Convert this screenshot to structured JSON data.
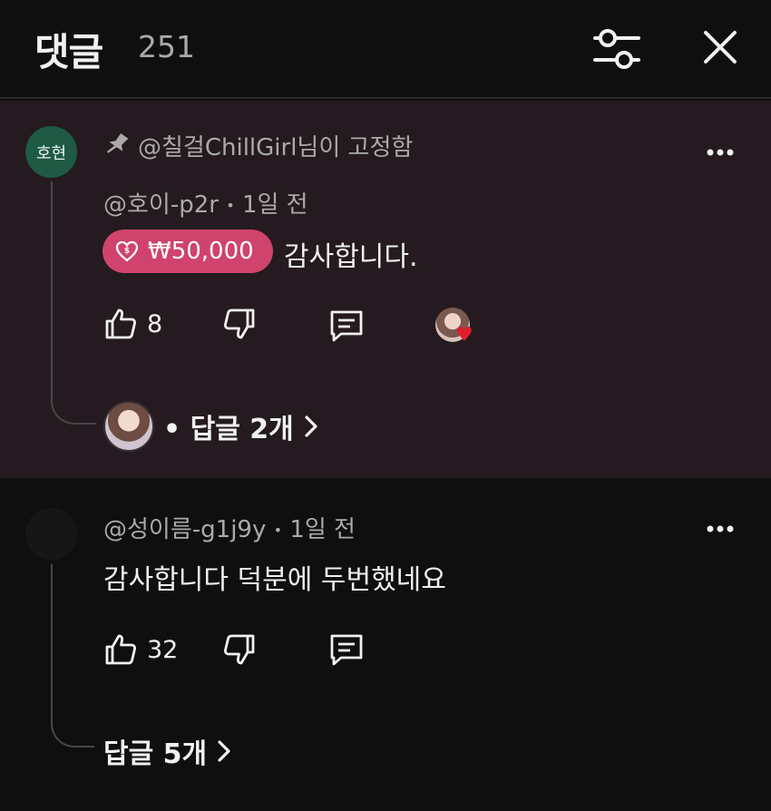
{
  "header": {
    "title": "댓글",
    "count": "251"
  },
  "pinned_comment": {
    "avatar_text": "호현",
    "pinned_label": "@칠걸ChillGirl님이 고정함",
    "author": "@호이-p2r",
    "separator": "•",
    "time": "1일 전",
    "thanks_amount": "₩50,000",
    "text": "감사합니다.",
    "likes": "8",
    "replies_label": "• 답글 2개",
    "colors": {
      "background": "#241a1f",
      "thanks_badge": "#d0436c",
      "heart": "#e11d2a"
    }
  },
  "second_comment": {
    "author": "@성이름-g1j9y",
    "separator": "•",
    "time": "1일 전",
    "text": "감사합니다 덕분에 두번했네요",
    "likes": "32",
    "replies_label": "답글 5개"
  },
  "icons": {
    "filter": "sliders-icon",
    "close": "close-icon",
    "pin": "pin-icon",
    "more": "more-vert-icon",
    "like": "thumb-up-icon",
    "dislike": "thumb-down-icon",
    "reply": "comment-icon",
    "thanks": "heart-dollar-icon",
    "chevron": "chevron-right-icon"
  }
}
